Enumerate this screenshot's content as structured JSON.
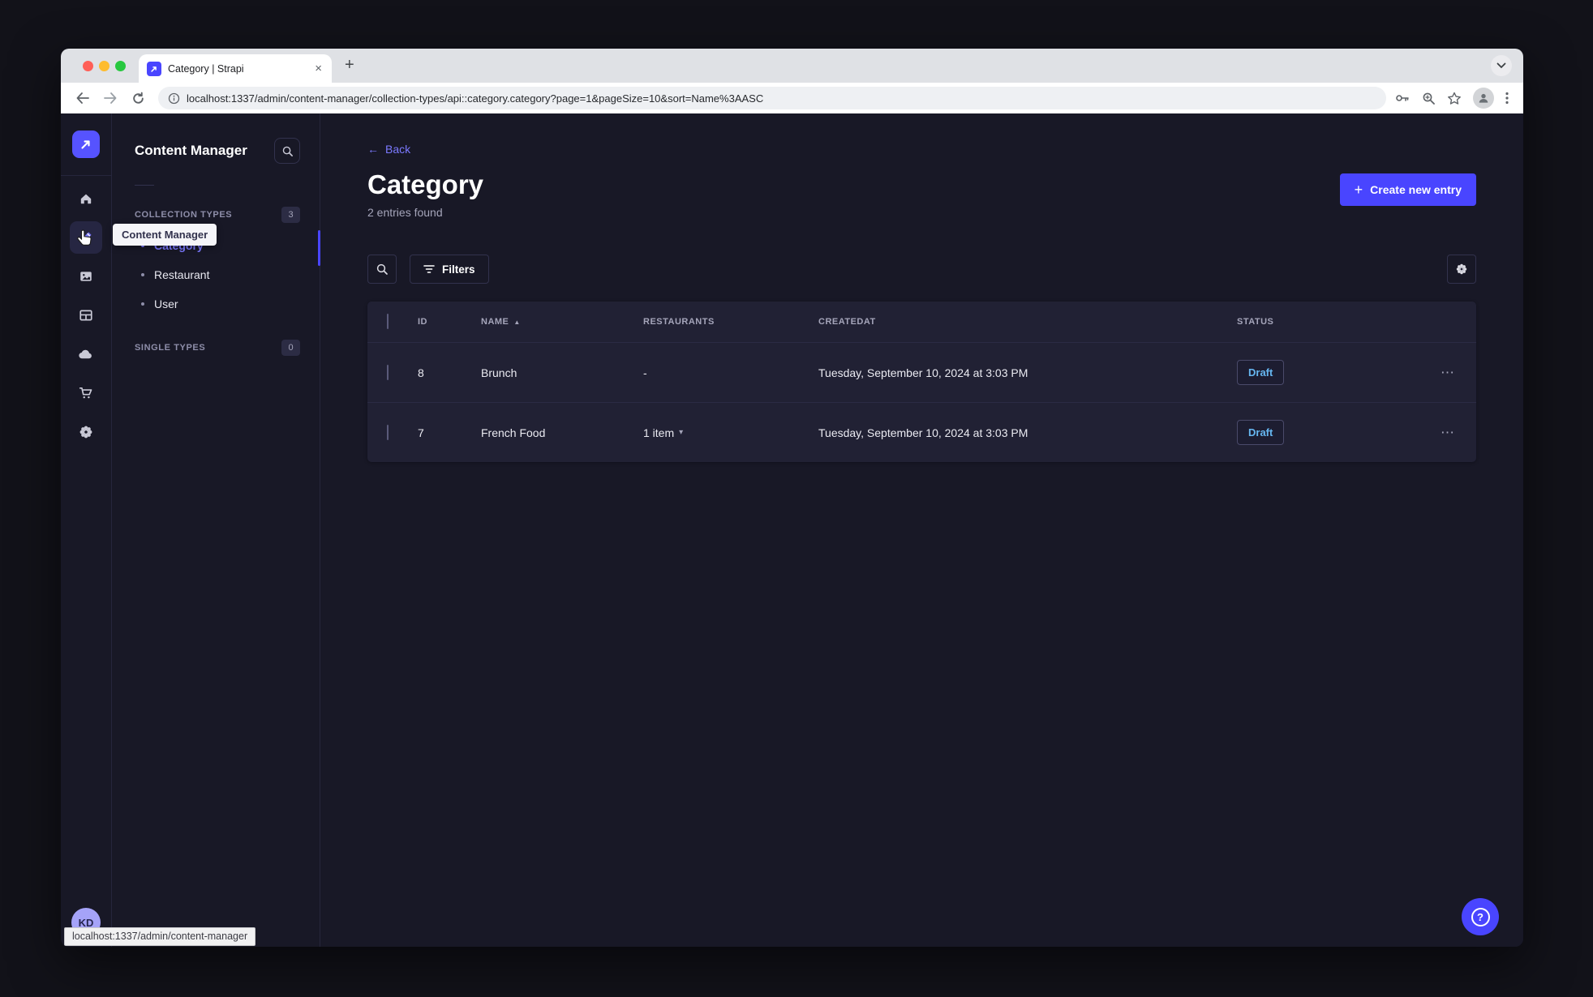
{
  "browser": {
    "tab_title": "Category | Strapi",
    "url": "localhost:1337/admin/content-manager/collection-types/api::category.category?page=1&pageSize=10&sort=Name%3AASC"
  },
  "icons": {
    "close": "×",
    "new_tab": "+",
    "back_arrow": "←",
    "ellipsis": "⋯",
    "sort_asc": "▲",
    "chevron_down": "▾",
    "plus": "+",
    "question_mark": "?"
  },
  "rail": {
    "avatar_initials": "KD",
    "tooltip": "Content Manager"
  },
  "subnav": {
    "title": "Content Manager",
    "collection_types_label": "COLLECTION TYPES",
    "collection_types_badge": "3",
    "single_types_label": "SINGLE TYPES",
    "single_types_badge": "0",
    "items": [
      {
        "label": "Category"
      },
      {
        "label": "Restaurant"
      },
      {
        "label": "User"
      }
    ]
  },
  "statusbar": {
    "link_preview": "localhost:1337/admin/content-manager"
  },
  "main": {
    "back_label": "Back",
    "title": "Category",
    "subtitle": "2 entries found",
    "create_button_label": "Create new entry",
    "filters_button_label": "Filters",
    "table": {
      "headers": {
        "id": "ID",
        "name": "NAME",
        "restaurants": "RESTAURANTS",
        "createdat": "CREATEDAT",
        "status": "STATUS"
      },
      "rows": [
        {
          "id": "8",
          "name": "Brunch",
          "restaurants": "-",
          "createdat": "Tuesday, September 10, 2024 at 3:03 PM",
          "status": "Draft"
        },
        {
          "id": "7",
          "name": "French Food",
          "restaurants": "1 item",
          "createdat": "Tuesday, September 10, 2024 at 3:03 PM",
          "status": "Draft"
        }
      ]
    }
  },
  "colors": {
    "primary": "#4945ff",
    "link": "#7b79ff",
    "app_bg": "#181826",
    "surface": "#212134",
    "draft_text": "#66b7f1"
  }
}
